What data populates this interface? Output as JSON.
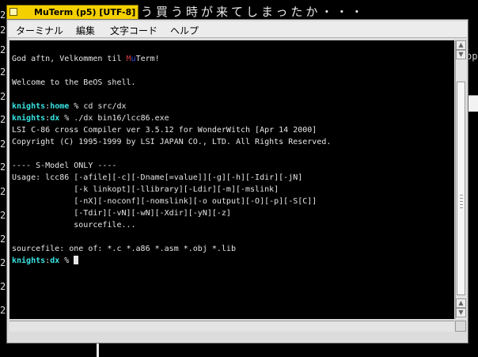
{
  "window": {
    "title": "MuTerm (p5) [UTF-8]"
  },
  "background": {
    "japanese_text": "う買う時が来てしまったか・・・",
    "right_fragment": "op"
  },
  "menu": [
    {
      "label": "ターミナル"
    },
    {
      "label": "編集"
    },
    {
      "label": "文字コード"
    },
    {
      "label": "ヘルプ"
    }
  ],
  "terminal": {
    "greeting_prefix": "God aftn, Velkommen til ",
    "greeting_mu1": "M",
    "greeting_mu2": "u",
    "greeting_suffix": "Term!",
    "welcome": "Welcome to the BeOS shell.",
    "prompt1_user": "knights",
    "prompt1_colon": ":",
    "prompt1_dir": "home",
    "prompt1_cmd": " % cd src/dx",
    "prompt2_user": "knights",
    "prompt2_colon": ":",
    "prompt2_dir": "dx",
    "prompt2_cmd": " % ./dx bin16/lcc86.exe",
    "output": [
      "LSI C-86 cross Compiler ver 3.5.12 for WonderWitch [Apr 14 2000]",
      "Copyright (C) 1995-1999 by LSI JAPAN CO., LTD. All Rights Reserved.",
      "",
      "---- S-Model ONLY ----",
      "Usage: lcc86 [-afile][-c][-Dname[=value]][-g][-h][-Idir][-jN]",
      "             [-k linkopt][-llibrary][-Ldir][-m][-mslink]",
      "             [-nX][-noconf][-nomslink][-o output][-O][-p][-S[C]]",
      "             [-Tdir][-vN][-wN][-Xdir][-yN][-z]",
      "             sourcefile...",
      "",
      "sourcefile: one of: *.c *.a86 *.asm *.obj *.lib"
    ],
    "prompt3_user": "knights",
    "prompt3_colon": ":",
    "prompt3_dir": "dx",
    "prompt3_cmd": " % "
  },
  "icons": {
    "close": "close-box-icon",
    "up": "scroll-up-arrow-icon",
    "down": "scroll-down-arrow-icon",
    "left": "scroll-left-arrow-icon",
    "right": "scroll-right-arrow-icon",
    "resize": "resize-grip-icon"
  },
  "colors": {
    "tab": "#f5d000",
    "prompt": "#39e5e5",
    "mu_m": "#d23b3b",
    "mu_u": "#3b4ee6",
    "terminal_bg": "#000000",
    "terminal_fg": "#e6e6e6"
  }
}
